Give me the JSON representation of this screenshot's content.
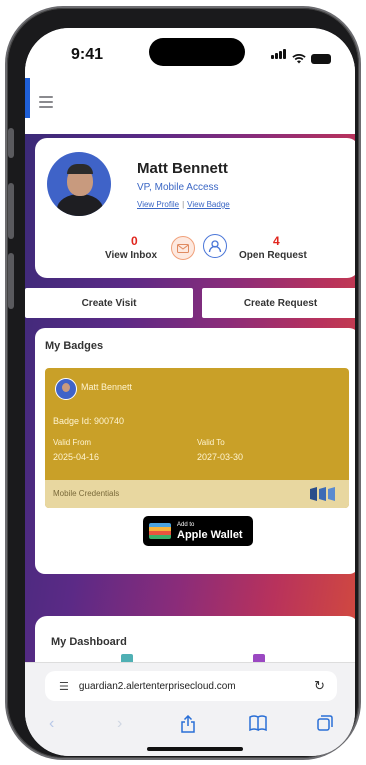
{
  "status_bar": {
    "time": "9:41"
  },
  "profile": {
    "name": "Matt Bennett",
    "title": "VP, Mobile Access",
    "view_profile": "View Profile",
    "separator": "|",
    "view_badge": "View Badge",
    "inbox_count": "0",
    "inbox_label": "View Inbox",
    "request_count": "4",
    "request_label": "Open Request"
  },
  "actions": {
    "create_visit": "Create Visit",
    "create_request": "Create Request"
  },
  "badges": {
    "title": "My Badges",
    "holder": "Matt Bennett",
    "badge_id": "Badge Id: 900740",
    "valid_from_label": "Valid From",
    "valid_from": "2025-04-16",
    "valid_to_label": "Valid To",
    "valid_to": "2027-03-30",
    "footer_label": "Mobile Credentials",
    "wallet_small": "Add to",
    "wallet_big": "Apple Wallet"
  },
  "dashboard": {
    "title": "My Dashboard"
  },
  "browser": {
    "url": "guardian2.alertenterprisecloud.com"
  },
  "colors": {
    "accent": "#1f5fd6",
    "badge_gold": "#c9a028",
    "alert_red": "#e0241c",
    "link_blue": "#3a66c4"
  },
  "icons": [
    "hamburger-icon",
    "mail-icon",
    "user-icon",
    "wallet-icon",
    "reload-icon",
    "back-icon",
    "forward-icon",
    "share-icon",
    "bookmarks-icon",
    "tabs-icon"
  ]
}
